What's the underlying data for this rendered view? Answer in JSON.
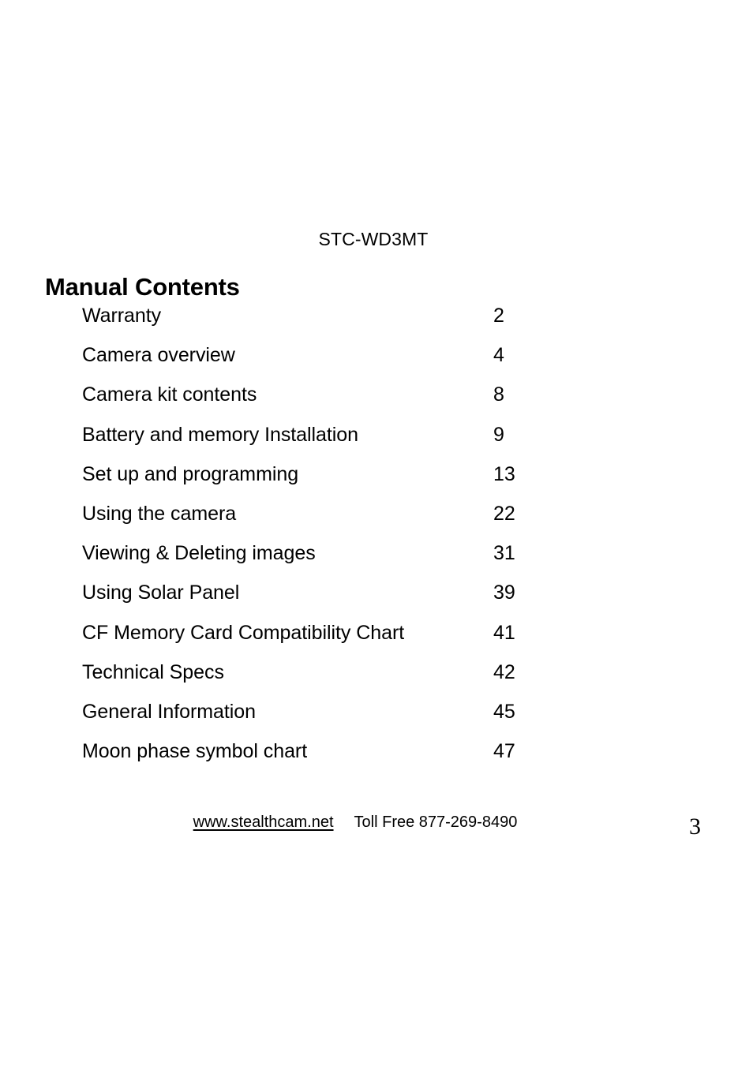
{
  "document": {
    "model_number": "STC-WD3MT",
    "title": "Manual Contents",
    "page_number": "3"
  },
  "toc": {
    "entries": [
      {
        "label": "Warranty",
        "page": "2"
      },
      {
        "label": "Camera overview",
        "page": "4"
      },
      {
        "label": "Camera kit contents",
        "page": "8"
      },
      {
        "label": "Battery and memory Installation",
        "page": "9"
      },
      {
        "label": "Set up and programming",
        "page": "13"
      },
      {
        "label": "Using the camera",
        "page": "22"
      },
      {
        "label": "Viewing & Deleting images",
        "page": "31"
      },
      {
        "label": "Using Solar Panel",
        "page": "39"
      },
      {
        "label": "CF Memory Card Compatibility Chart",
        "page": "41"
      },
      {
        "label": "Technical Specs",
        "page": "42"
      },
      {
        "label": "General Information",
        "page": "45"
      },
      {
        "label": "Moon phase symbol chart",
        "page": "47"
      }
    ]
  },
  "footer": {
    "website": "www.stealthcam.net",
    "phone": "Toll Free 877-269-8490"
  }
}
